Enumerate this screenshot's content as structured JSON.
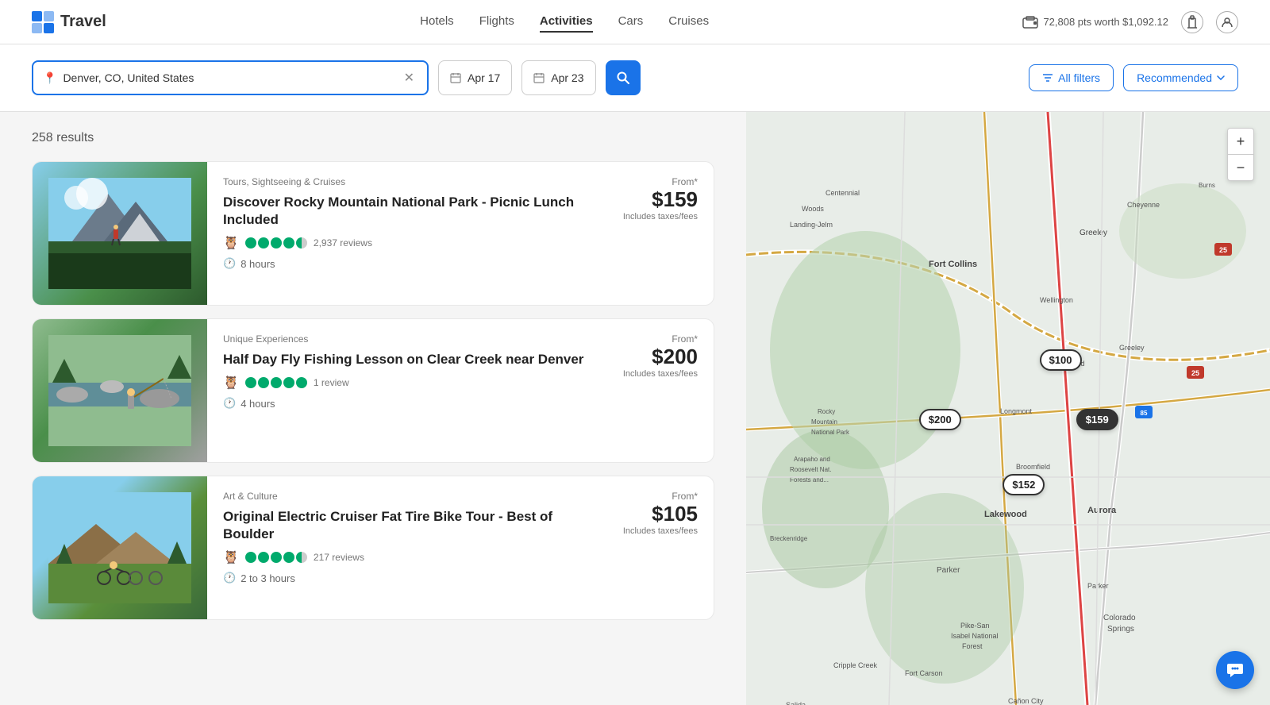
{
  "header": {
    "logo_text": "Travel",
    "nav_items": [
      {
        "label": "Hotels",
        "active": false
      },
      {
        "label": "Flights",
        "active": false
      },
      {
        "label": "Activities",
        "active": true
      },
      {
        "label": "Cars",
        "active": false
      },
      {
        "label": "Cruises",
        "active": false
      }
    ],
    "points": "72,808 pts worth $1,092.12"
  },
  "search": {
    "location_value": "Denver, CO, United States",
    "location_placeholder": "Denver, CO, United States",
    "date_start": "Apr 17",
    "date_end": "Apr 23",
    "all_filters_label": "All filters",
    "recommended_label": "Recommended"
  },
  "results": {
    "count_label": "258 results",
    "activities": [
      {
        "category": "Tours, Sightseeing & Cruises",
        "title": "Discover Rocky Mountain National Park - Picnic Lunch Included",
        "rating_count": "2,937 reviews",
        "duration": "8 hours",
        "price": "$159",
        "from_label": "From*",
        "includes_label": "Includes taxes/fees",
        "img_type": "mountain",
        "stars": [
          1,
          1,
          1,
          1,
          0.5
        ]
      },
      {
        "category": "Unique Experiences",
        "title": "Half Day Fly Fishing Lesson on Clear Creek near Denver",
        "rating_count": "1 review",
        "duration": "4 hours",
        "price": "$200",
        "from_label": "From*",
        "includes_label": "Includes taxes/fees",
        "img_type": "river",
        "stars": [
          1,
          1,
          1,
          1,
          1
        ]
      },
      {
        "category": "Art & Culture",
        "title": "Original Electric Cruiser Fat Tire Bike Tour - Best of Boulder",
        "rating_count": "217 reviews",
        "duration": "2 to 3 hours",
        "price": "$105",
        "from_label": "From*",
        "includes_label": "Includes taxes/fees",
        "img_type": "bike",
        "stars": [
          1,
          1,
          1,
          1,
          0.5
        ]
      }
    ]
  },
  "map": {
    "markers": [
      {
        "label": "$100",
        "x": 59,
        "y": 42,
        "selected": false
      },
      {
        "label": "$159",
        "x": 65,
        "y": 52,
        "selected": true
      },
      {
        "label": "$200",
        "x": 38,
        "y": 52,
        "selected": false
      },
      {
        "label": "$152",
        "x": 55,
        "y": 62,
        "selected": false
      }
    ],
    "zoom_in_label": "+",
    "zoom_out_label": "−"
  },
  "chat_icon": "💬"
}
